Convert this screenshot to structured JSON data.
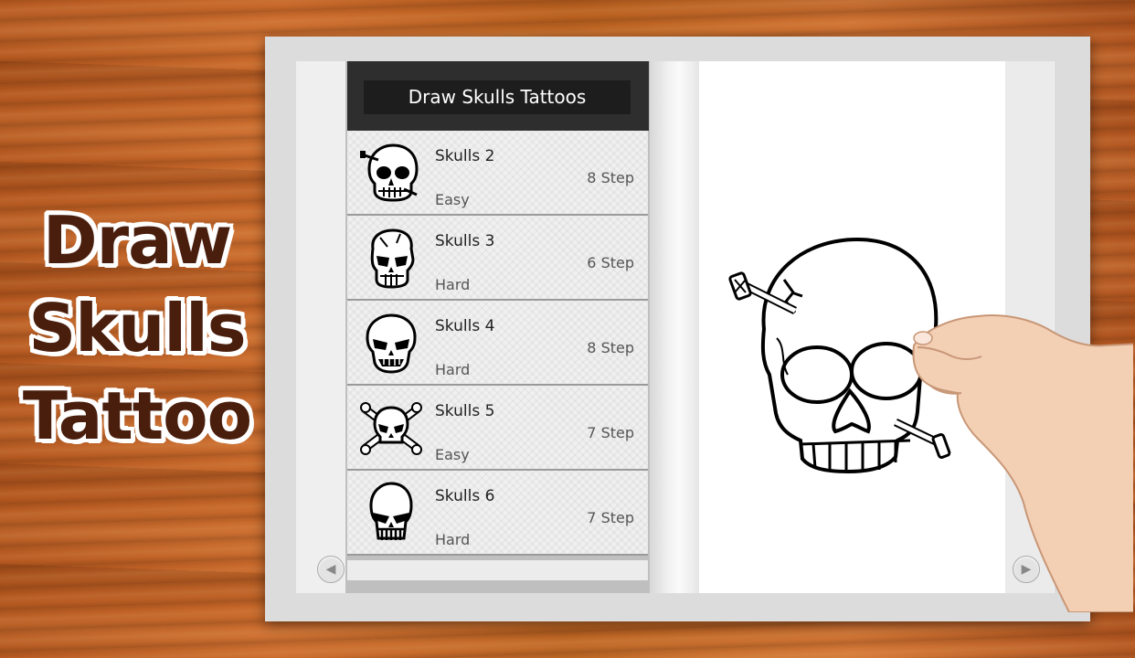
{
  "promo": {
    "line1": "Draw",
    "line2": "Skulls",
    "line3": "Tattoo"
  },
  "app": {
    "title": "Draw Skulls Tattoos"
  },
  "items": [
    {
      "name": "Skulls 2",
      "difficulty": "Easy",
      "steps": "8 Step",
      "icon": "skull-nail-icon"
    },
    {
      "name": "Skulls 3",
      "difficulty": "Hard",
      "steps": "6 Step",
      "icon": "skull-cracked-icon"
    },
    {
      "name": "Skulls 4",
      "difficulty": "Hard",
      "steps": "8 Step",
      "icon": "skull-fangs-icon"
    },
    {
      "name": "Skulls 5",
      "difficulty": "Easy",
      "steps": "7 Step",
      "icon": "skull-crossbones-icon"
    },
    {
      "name": "Skulls 6",
      "difficulty": "Hard",
      "steps": "7 Step",
      "icon": "skull-punisher-icon"
    }
  ],
  "nav": {
    "prev_icon": "arrow-left-icon",
    "next_icon": "arrow-right-icon"
  },
  "colors": {
    "header": "#2e2e2e",
    "wood": "#c0622a",
    "pencil": "#f2a03a"
  }
}
